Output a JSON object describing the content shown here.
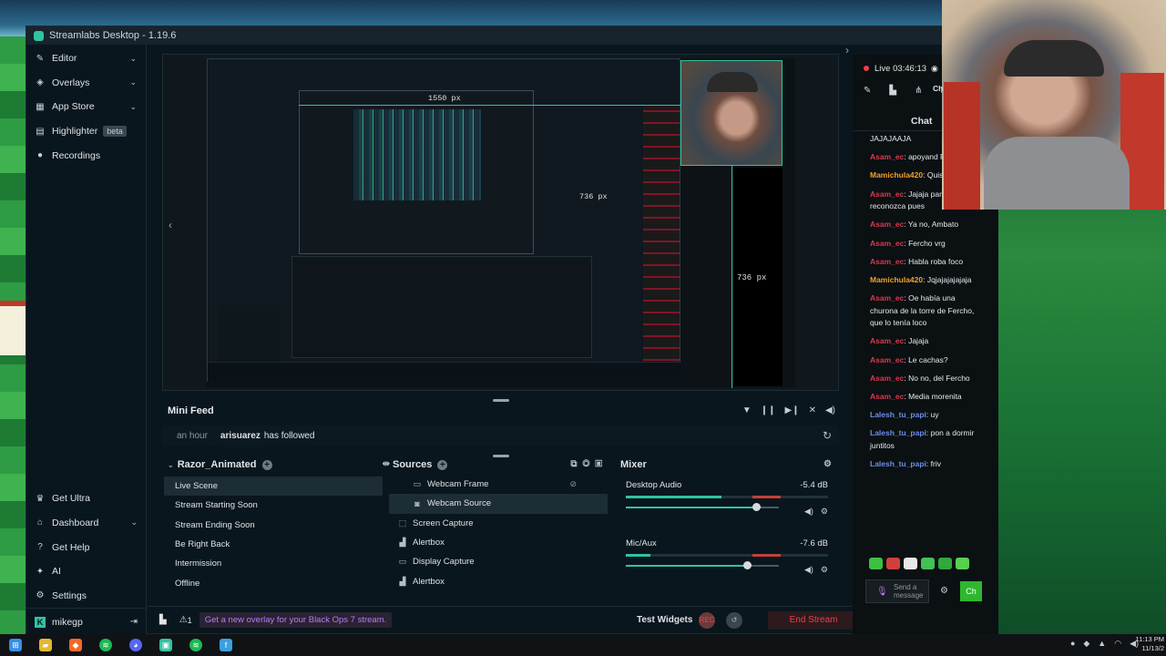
{
  "app": {
    "title": "Streamlabs Desktop - 1.19.6"
  },
  "sidebar": {
    "items": [
      {
        "label": "Editor",
        "icon": "edit-icon",
        "chevron": "⌄"
      },
      {
        "label": "Overlays",
        "icon": "layers-icon",
        "chevron": "⌄"
      },
      {
        "label": "App Store",
        "icon": "store-icon",
        "chevron": "⌄"
      },
      {
        "label": "Highlighter",
        "icon": "highlighter-icon",
        "badge": "beta"
      },
      {
        "label": "Recordings",
        "icon": "recordings-icon"
      }
    ],
    "bottom_items": [
      {
        "label": "Get Ultra",
        "icon": "ultra-icon"
      },
      {
        "label": "Dashboard",
        "icon": "dashboard-icon",
        "chevron": "⌄"
      },
      {
        "label": "Get Help",
        "icon": "help-icon"
      },
      {
        "label": "AI",
        "icon": "ai-icon"
      },
      {
        "label": "Settings",
        "icon": "gear-icon"
      }
    ],
    "user": {
      "name": "mikegp",
      "logout_glyph": "⇥"
    }
  },
  "preview": {
    "width_label": "1550 px",
    "height_label": "736 px",
    "nested_height_label": "736 px"
  },
  "mini_feed": {
    "title": "Mini Feed",
    "event": {
      "time": "an hour",
      "user": "arisuarez",
      "action": "has followed"
    }
  },
  "scenes": {
    "collection": "Razor_Animated",
    "items": [
      "Live Scene",
      "Stream Starting Soon",
      "Stream Ending Soon",
      "Be Right Back",
      "Intermission",
      "Offline"
    ],
    "selected": "Live Scene"
  },
  "sources": {
    "title": "Sources",
    "items": [
      {
        "label": "Webcam Frame",
        "icon": "image-icon",
        "child": true
      },
      {
        "label": "Webcam Source",
        "icon": "camera-icon",
        "child": true,
        "selected": true
      },
      {
        "label": "Screen Capture",
        "icon": "screen-capture-icon",
        "child": false
      },
      {
        "label": "Alertbox",
        "icon": "alertbox-icon",
        "child": false
      },
      {
        "label": "Display Capture",
        "icon": "display-icon",
        "child": false
      },
      {
        "label": "Alertbox",
        "icon": "alertbox-icon",
        "child": false
      }
    ]
  },
  "mixer": {
    "title": "Mixer",
    "channels": [
      {
        "name": "Desktop Audio",
        "db": "-5.4 dB",
        "level": 0.79,
        "volume": 0.85
      },
      {
        "name": "Mic/Aux",
        "db": "-7.6 dB",
        "level": 0.2,
        "volume": 0.79
      }
    ]
  },
  "footer": {
    "alert_count": "1",
    "promo": "Get a new overlay for your Black Ops 7 stream.",
    "test_widgets": "Test Widgets",
    "end_stream": "End Stream"
  },
  "live": {
    "status": "Live 03:46:13",
    "re_label": "Re",
    "ch_label": "Ch"
  },
  "chat": {
    "title": "Chat",
    "messages": [
      {
        "user": "",
        "text": "JAJAJAAJA",
        "color": "#e6e9eb"
      },
      {
        "user": "Asam_ec",
        "text": "apoyand Pues Sapin",
        "color": "#d8394f"
      },
      {
        "user": "Mamichula420",
        "text": "Quisieras 🍠",
        "color": "#f0a12a"
      },
      {
        "user": "Asam_ec",
        "text": "Jajaja para que reconozca pues",
        "color": "#d8394f"
      },
      {
        "user": "Asam_ec",
        "text": "Ya no, Ambato",
        "color": "#d8394f"
      },
      {
        "user": "Asam_ec",
        "text": "Fercho vrg",
        "color": "#d8394f"
      },
      {
        "user": "Asam_ec",
        "text": "Habla roba foco",
        "color": "#d8394f"
      },
      {
        "user": "Mamichula420",
        "text": "Jqjajajajajaja",
        "color": "#f0a12a"
      },
      {
        "user": "Asam_ec",
        "text": "Oe había una churona de la torre de Fercho, que lo tenía loco",
        "color": "#d8394f"
      },
      {
        "user": "Asam_ec",
        "text": "Jajaja",
        "color": "#d8394f"
      },
      {
        "user": "Asam_ec",
        "text": "Le cachas?",
        "color": "#d8394f"
      },
      {
        "user": "Asam_ec",
        "text": "No no, del Fercho",
        "color": "#d8394f"
      },
      {
        "user": "Asam_ec",
        "text": "Media morenita",
        "color": "#d8394f"
      },
      {
        "user": "Lalesh_tu_papi",
        "text": "uy",
        "color": "#6c8ee8"
      },
      {
        "user": "Lalesh_tu_papi",
        "text": "pon a dormir juntitos",
        "color": "#6c8ee8"
      },
      {
        "user": "Lalesh_tu_papi",
        "text": "friv",
        "color": "#6c8ee8"
      }
    ],
    "input_placeholder": "Send a message",
    "send_label": "Ch"
  },
  "taskbar": {
    "time": "11:13 PM",
    "date": "11/13/2"
  },
  "colors": {
    "accent": "#31c3a2",
    "live": "#ef3e4a",
    "promo": "#b97cf1"
  }
}
